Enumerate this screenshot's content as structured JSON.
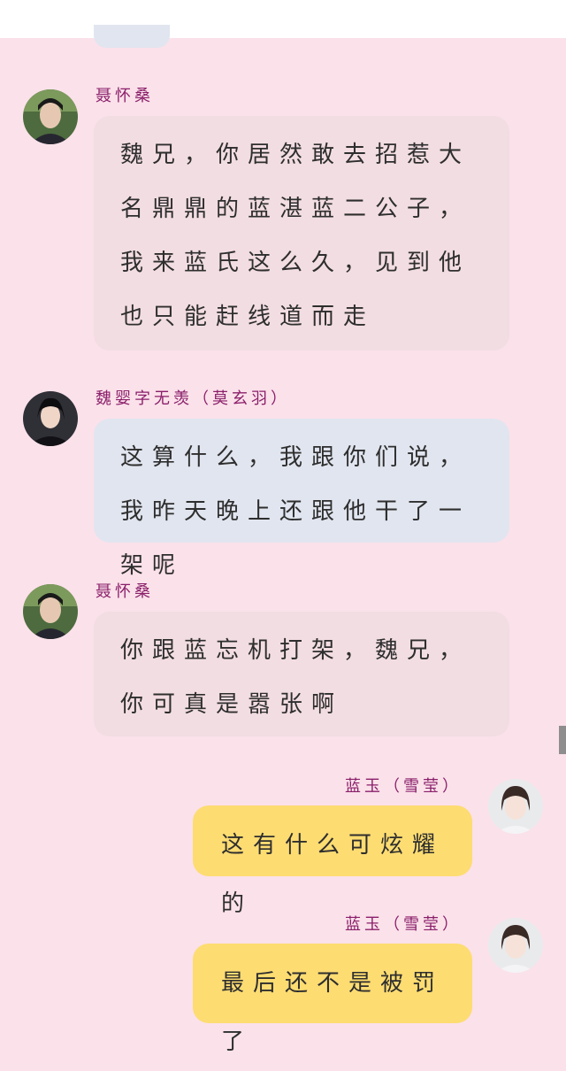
{
  "messages": [
    {
      "sender": "聂怀桑",
      "avatar": "male-avatar-nie",
      "side": "left",
      "text": "魏兄，你居然敢去招惹大名鼎鼎的蓝湛蓝二公子，我来蓝氏这么久，见到他也只能赶线道而走"
    },
    {
      "sender": "魏婴字无羡（莫玄羽）",
      "avatar": "male-avatar-wei",
      "side": "left",
      "text": "这算什么，我跟你们说，我昨天晚上还跟他干了一架呢"
    },
    {
      "sender": "聂怀桑",
      "avatar": "male-avatar-nie",
      "side": "left",
      "text": "你跟蓝忘机打架，魏兄，你可真是嚣张啊"
    },
    {
      "sender": "蓝玉（雪莹）",
      "avatar": "female-avatar-lan",
      "side": "right",
      "text": "这有什么可炫耀的"
    },
    {
      "sender": "蓝玉（雪莹）",
      "avatar": "female-avatar-lan",
      "side": "right",
      "text": "最后还不是被罚了"
    }
  ],
  "colors": {
    "background": "#fbe1ea",
    "bubble_pink": "#f2dde2",
    "bubble_blue": "#e1e5ef",
    "bubble_yellow": "#fddc72",
    "name": "#8a1f6a"
  }
}
